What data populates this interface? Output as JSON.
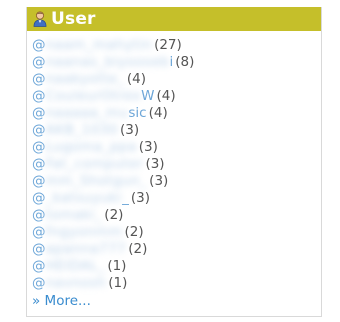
{
  "widget": {
    "title": "User",
    "icon": "user-icon",
    "header_color": "#c5bf2a",
    "more_link": "» More..."
  },
  "users": [
    {
      "prefix": "@",
      "name": "naam_mahytin",
      "suffix": "",
      "count": "(27)"
    },
    {
      "prefix": "@",
      "name": "naanas_biyooseb",
      "suffix": "i",
      "count": "(8)"
    },
    {
      "prefix": "@",
      "name": "naakyotte_",
      "suffix": "",
      "count": "(4)"
    },
    {
      "prefix": "@",
      "name": "CouleurOtrex",
      "suffix": "W",
      "count": "(4)"
    },
    {
      "prefix": "@",
      "name": "naaaaa_mu",
      "suffix": "sic",
      "count": "(4)"
    },
    {
      "prefix": "@",
      "name": "AKB_1030",
      "suffix": "",
      "count": "(3)"
    },
    {
      "prefix": "@",
      "name": "Lugoma_ppa",
      "suffix": "",
      "count": "(3)"
    },
    {
      "prefix": "@",
      "name": "Fat_computer",
      "suffix": "",
      "count": "(3)"
    },
    {
      "prefix": "@",
      "name": "mm_Shotgun_",
      "suffix": "",
      "count": "(3)"
    },
    {
      "prefix": "@",
      "name": "_katsuyuki",
      "suffix": "_",
      "count": "(3)"
    },
    {
      "prefix": "@",
      "name": "tomaki_",
      "suffix": "",
      "count": "(2)"
    },
    {
      "prefix": "@",
      "name": "fngyonmm",
      "suffix": "",
      "count": "(2)"
    },
    {
      "prefix": "@",
      "name": "apanna777",
      "suffix": "",
      "count": "(2)"
    },
    {
      "prefix": "@",
      "name": "HEIDAL_",
      "suffix": "",
      "count": "(1)"
    },
    {
      "prefix": "@",
      "name": "navnosh",
      "suffix": "",
      "count": "(1)"
    }
  ]
}
